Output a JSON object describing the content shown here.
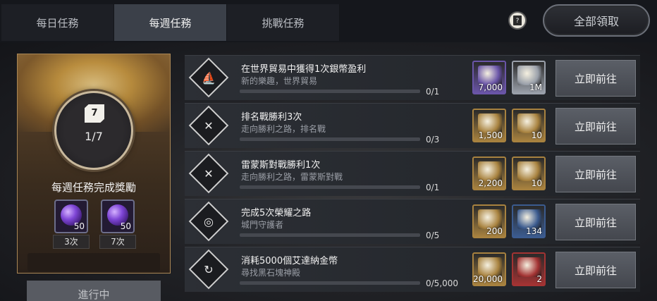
{
  "tabs": [
    {
      "label": "每日任務"
    },
    {
      "label": "每週任務"
    },
    {
      "label": "挑戰任務"
    }
  ],
  "header": {
    "help_icon": "book-help-icon",
    "claim_all_label": "全部領取"
  },
  "reward_panel": {
    "medal_icon_number": "7",
    "count": "1/7",
    "title": "每週任務完成獎勵",
    "items": [
      {
        "qty": "50",
        "tag": "3次",
        "icon": "purple-orb-icon"
      },
      {
        "qty": "50",
        "tag": "7次",
        "icon": "purple-orb-icon"
      }
    ],
    "status_label": "進行中"
  },
  "missions": [
    {
      "title": "在世界貿易中獲得1次銀幣盈利",
      "subtitle": "新的樂趣，世界貿易",
      "progress": "0/1",
      "progress_fraction": 0,
      "icon": "trade-ship-icon",
      "rewards": [
        {
          "qty": "7,000",
          "icon": "ticket-stack-icon",
          "color": "#6a55a8"
        },
        {
          "qty": "1M",
          "icon": "silver-coin-icon",
          "color": "#9aa0aa"
        }
      ],
      "button_label": "立即前往"
    },
    {
      "title": "排名戰勝利3次",
      "subtitle": "走向勝利之路，排名戰",
      "progress": "0/3",
      "progress_fraction": 0,
      "icon": "crossed-swords-icon",
      "rewards": [
        {
          "qty": "1,500",
          "icon": "scroll-icon",
          "color": "#a8823f"
        },
        {
          "qty": "10",
          "icon": "medal-icon",
          "color": "#a8823f"
        }
      ],
      "button_label": "立即前往"
    },
    {
      "title": "雷蒙斯對戰勝利1次",
      "subtitle": "走向勝利之路，雷蒙斯對戰",
      "progress": "0/1",
      "progress_fraction": 0,
      "icon": "crossed-swords-icon",
      "rewards": [
        {
          "qty": "2,200",
          "icon": "stone-tablet-icon",
          "color": "#a8823f"
        },
        {
          "qty": "10",
          "icon": "medal-icon",
          "color": "#a8823f"
        }
      ],
      "button_label": "立即前往"
    },
    {
      "title": "完成5次榮耀之路",
      "subtitle": "城門守護者",
      "progress": "0/5",
      "progress_fraction": 0,
      "icon": "spiral-gate-icon",
      "rewards": [
        {
          "qty": "200",
          "icon": "bronze-coin-icon",
          "color": "#a8823f"
        },
        {
          "qty": "134",
          "icon": "blue-crest-icon",
          "color": "#3b5b8f"
        }
      ],
      "button_label": "立即前往"
    },
    {
      "title": "消耗5000個艾達納金幣",
      "subtitle": "尋找黑石塊神殿",
      "progress": "0/5,000",
      "progress_fraction": 0,
      "icon": "refresh-cycle-icon",
      "rewards": [
        {
          "qty": "20,000",
          "icon": "gold-pile-icon",
          "color": "#a8823f"
        },
        {
          "qty": "2",
          "icon": "red-banner-icon",
          "color": "#a33333"
        }
      ],
      "button_label": "立即前往"
    }
  ]
}
